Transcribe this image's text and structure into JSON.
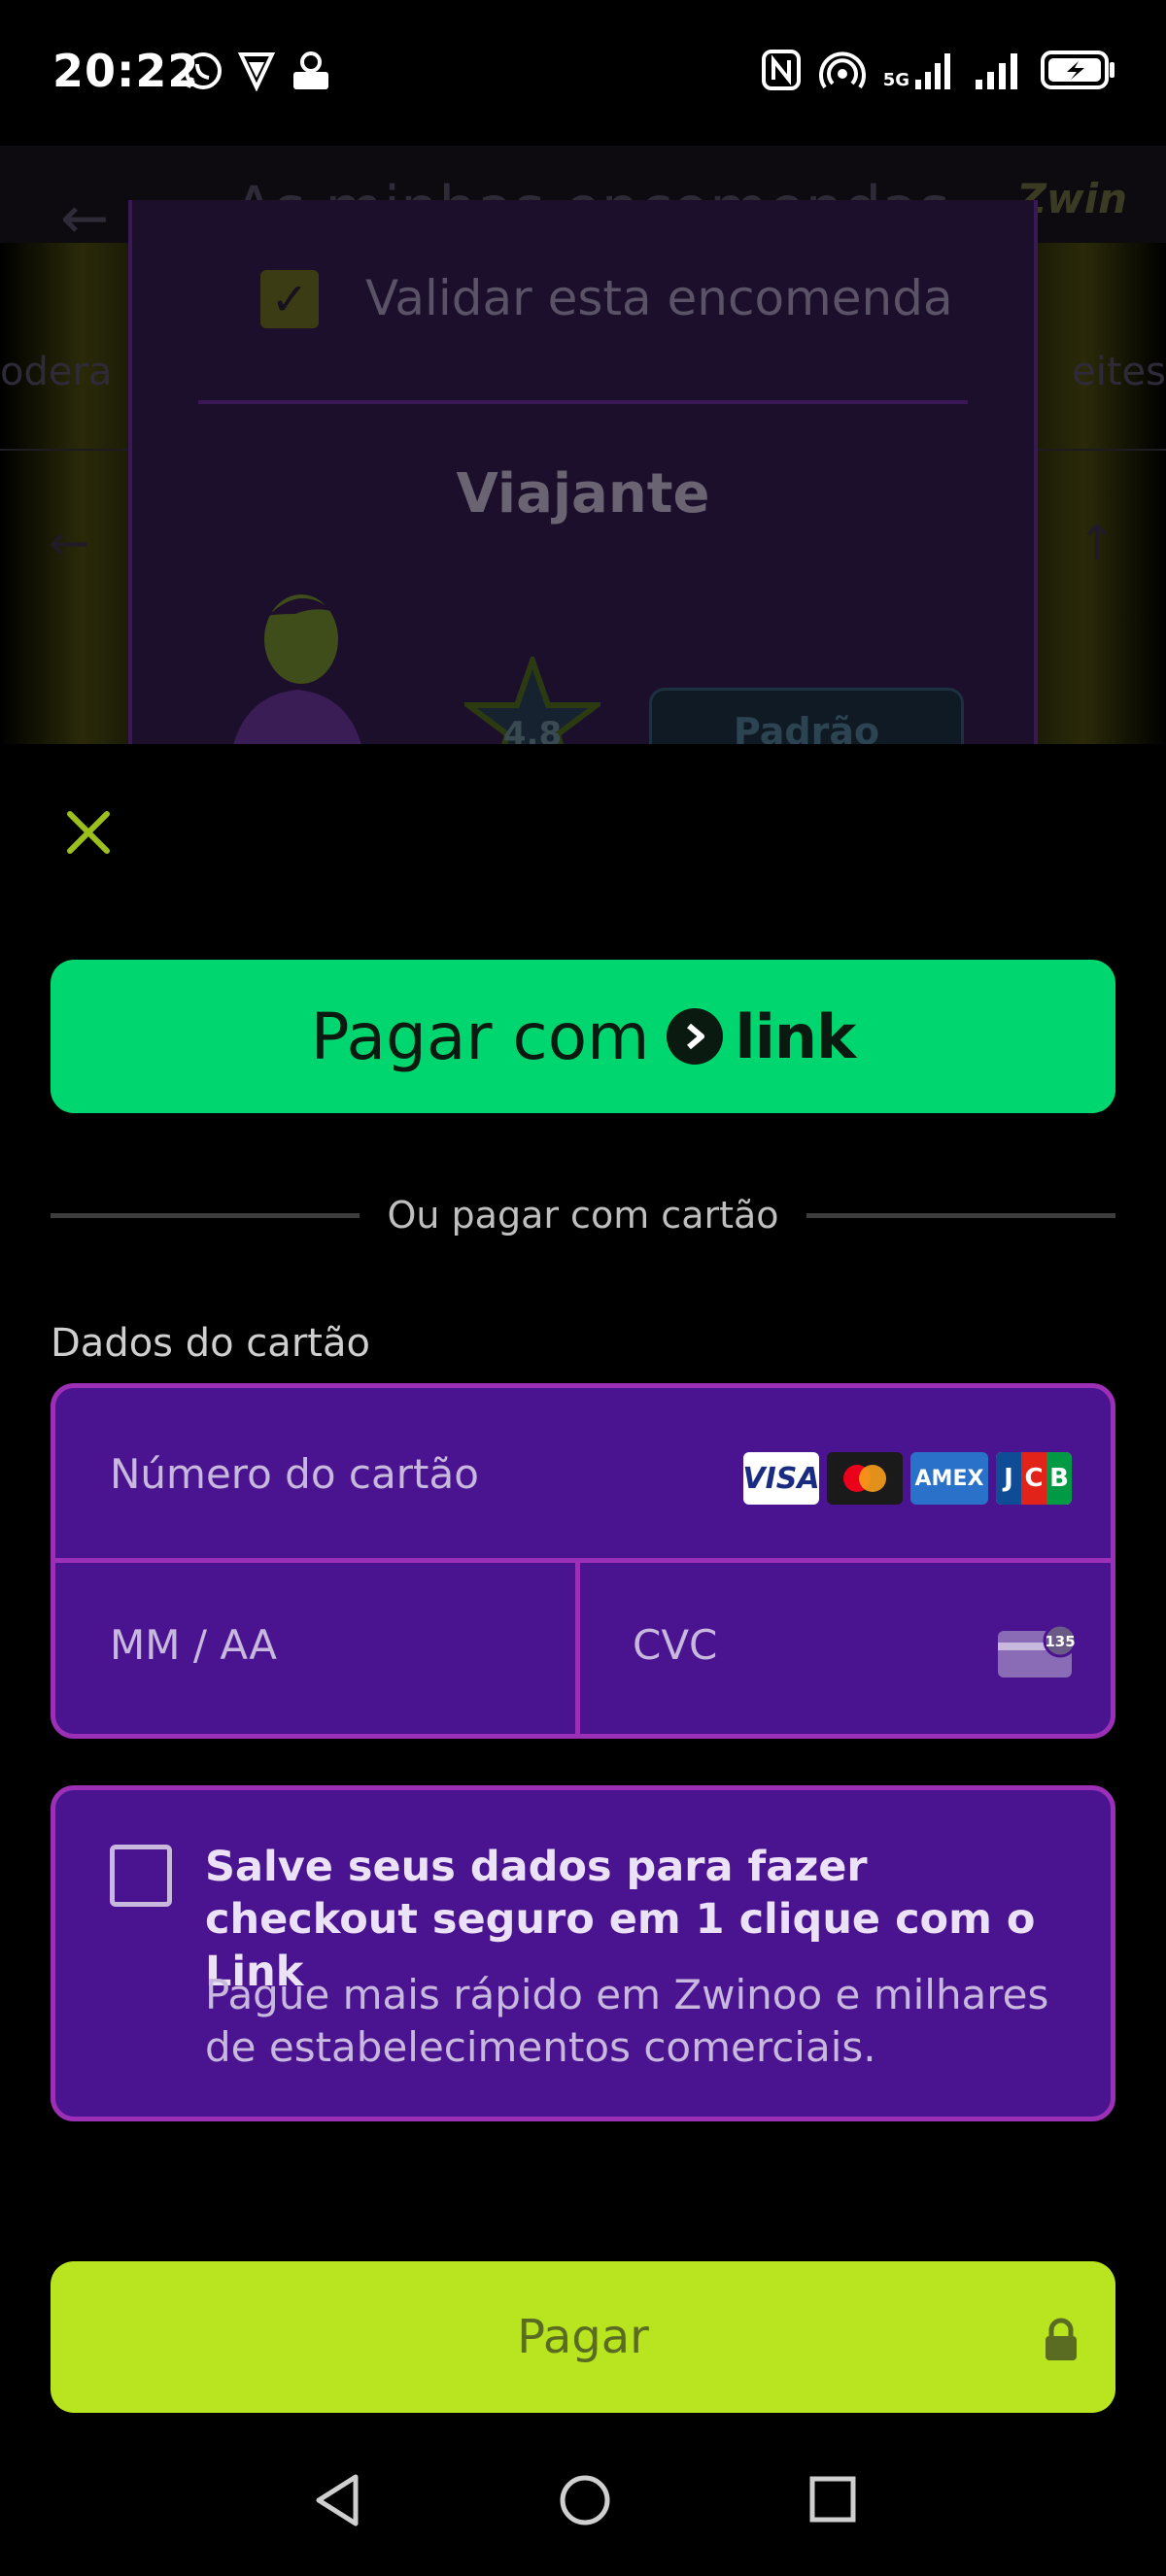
{
  "status_bar": {
    "time": "20:22",
    "network_label": "5G"
  },
  "background_app": {
    "header_title": "As minhas encomendas",
    "tab_left": "odera",
    "tab_right": "eites",
    "logo": "Zwin",
    "dialog": {
      "validate_label": "Validar esta encomenda",
      "role_title": "Viajante",
      "rating": "4.8",
      "standard_badge": "Padrão"
    }
  },
  "sheet": {
    "pay_with_label": "Pagar com",
    "link_word": "link",
    "or_text": "Ou pagar com cartão",
    "card_section_label": "Dados do cartão",
    "card_number_placeholder": "Número do cartão",
    "expiry_placeholder": "MM / AA",
    "cvc_placeholder": "CVC",
    "cvc_badge": "135",
    "brands": [
      "VISA",
      "Mastercard",
      "AMEX",
      "JCB"
    ],
    "save_title": "Salve seus dados para fazer checkout seguro em 1 clique com o Link",
    "save_description": "Pague mais rápido em Zwinoo e milhares de estabelecimentos comerciais.",
    "pay_button_label": "Pagar"
  },
  "colors": {
    "link_green": "#00d66f",
    "card_purple": "#4a1490",
    "border_purple": "#9b2fb5",
    "pay_lime": "#b8e51f",
    "close_icon": "#9bbf1c"
  }
}
